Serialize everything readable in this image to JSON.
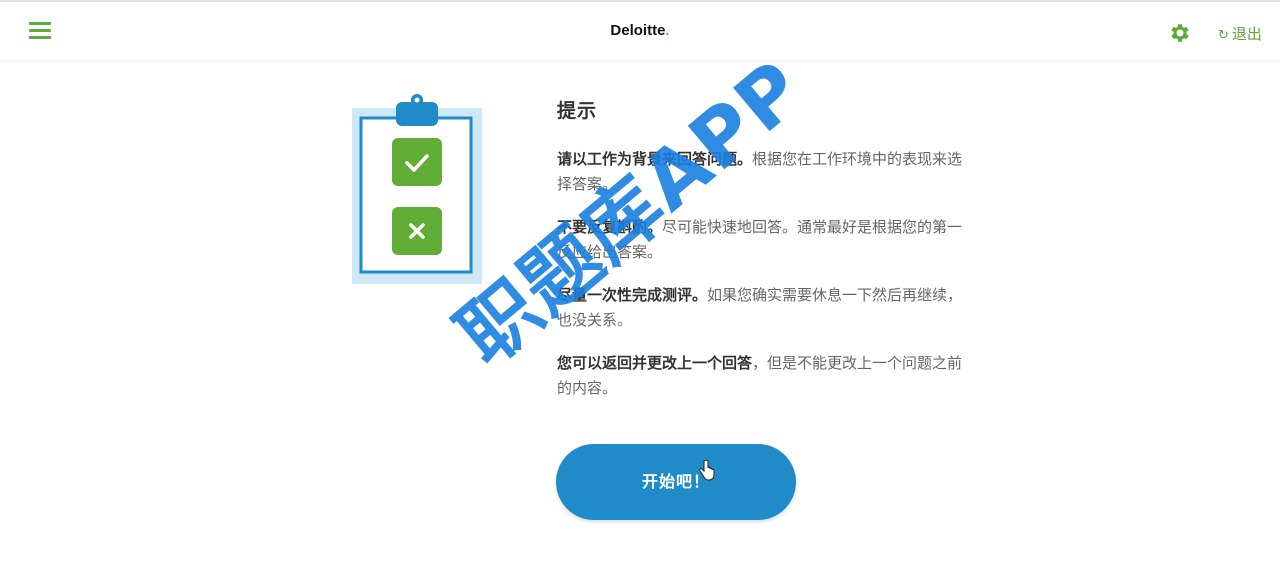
{
  "header": {
    "brand": "Deloitte",
    "brand_dot": ".",
    "logout_label": "退出",
    "logout_icon": "logout-icon",
    "settings_icon": "gear-icon",
    "menu_icon": "hamburger-icon"
  },
  "tips": {
    "title": "提示",
    "items": [
      {
        "bold": "请以工作为背景来回答问题。",
        "text": "根据您在工作环境中的表现来选择答案。"
      },
      {
        "bold": "不要反复斟酌。",
        "text": "尽可能快速地回答。通常最好是根据您的第一反应给出答案。"
      },
      {
        "bold": "尽量一次性完成测评。",
        "text": "如果您确实需要休息一下然后再继续，也没关系。"
      },
      {
        "bold": "您可以返回并更改上一个回答",
        "text": "，但是不能更改上一个问题之前的内容。"
      }
    ]
  },
  "start_button": {
    "label": "开始吧！"
  },
  "watermark": "职题库APP",
  "colors": {
    "green": "#5fa83a",
    "deloitte_green": "#86bc25",
    "blue": "#1f8bc9",
    "watermark": "#1a7fe0"
  }
}
